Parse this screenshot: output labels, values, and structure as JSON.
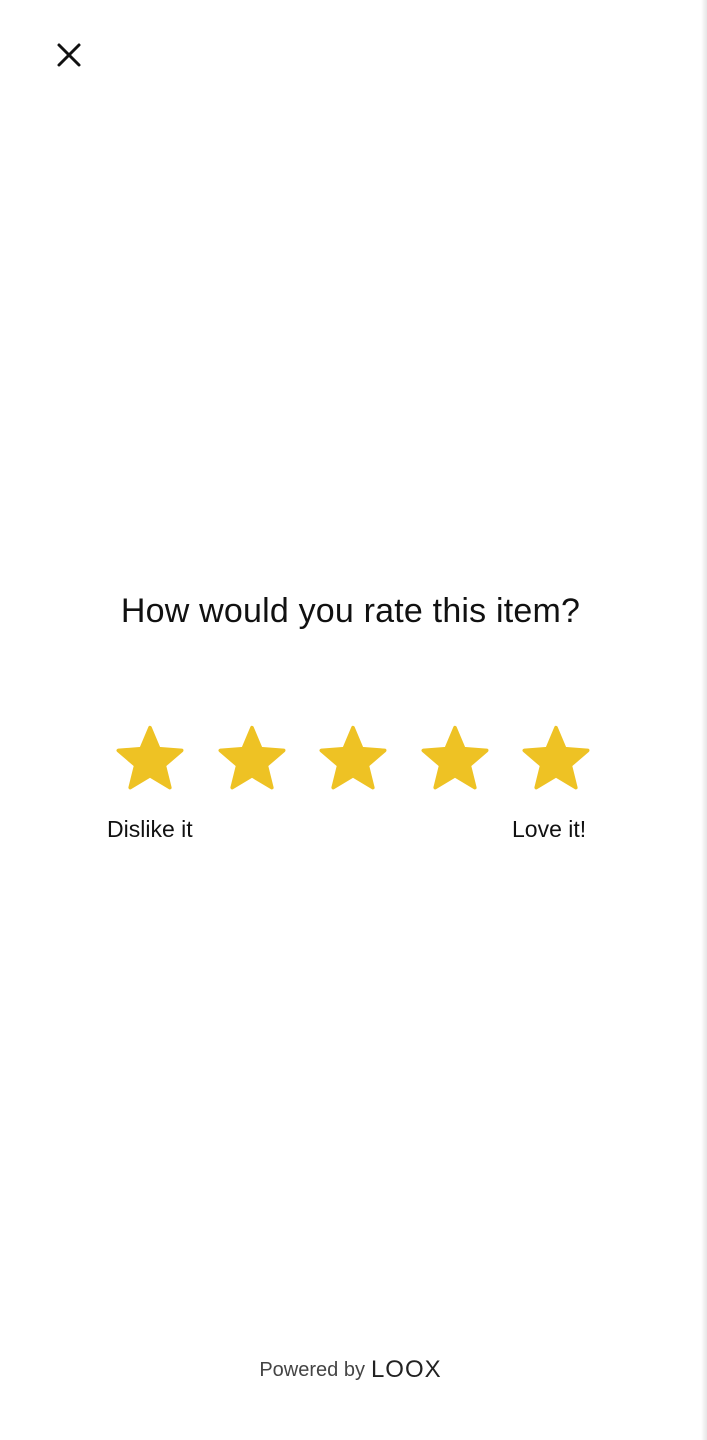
{
  "dialog": {
    "close_label": "close"
  },
  "rating": {
    "question": "How would you rate this item?",
    "max_stars": 5,
    "stars": [
      "1",
      "2",
      "3",
      "4",
      "5"
    ],
    "low_label": "Dislike it",
    "high_label": "Love it!",
    "star_color": "#EEC224"
  },
  "footer": {
    "powered_by": "Powered by",
    "brand": "LOOX"
  },
  "icons": {
    "close": "close-icon",
    "star": "star-icon"
  }
}
